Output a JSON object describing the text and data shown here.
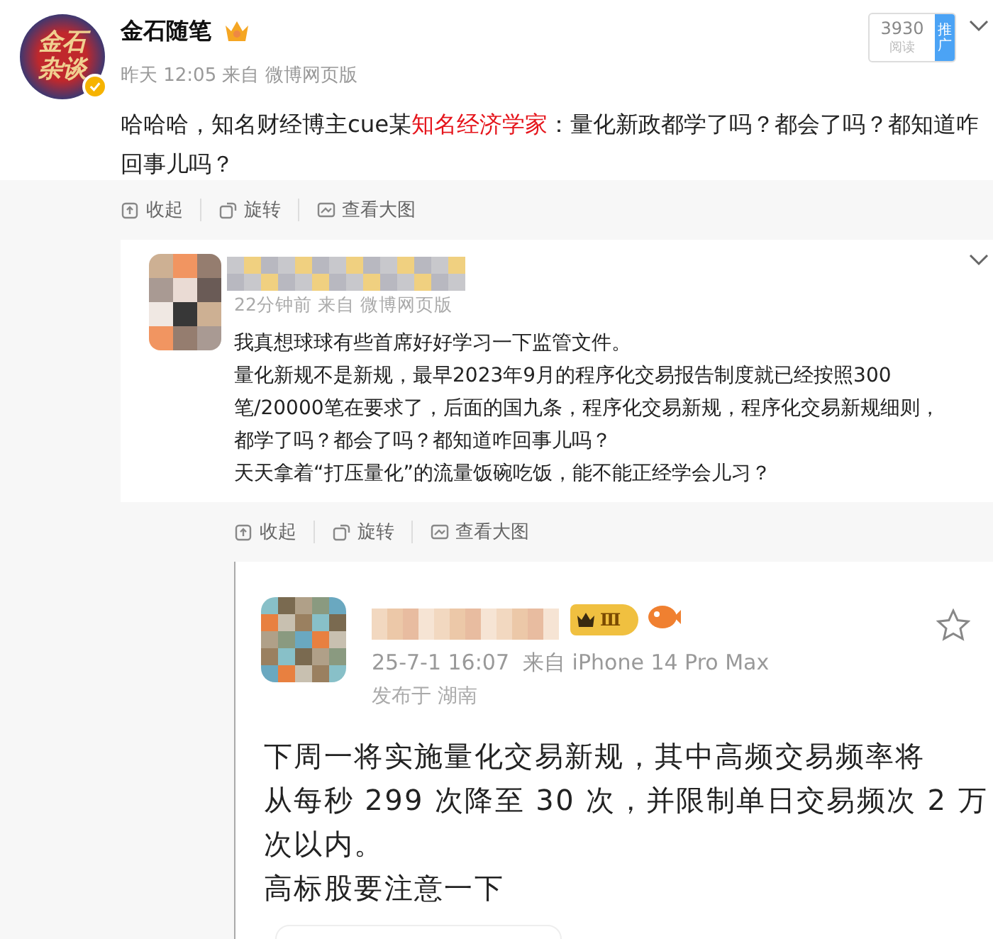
{
  "post": {
    "author": "金石随笔",
    "avatar_text": [
      "金石",
      "杂谈"
    ],
    "verified": true,
    "meta": "昨天 12:05 来自 微博网页版",
    "read_count": "3930",
    "read_label": "阅读",
    "promo": "推广",
    "text_parts": [
      {
        "text": "哈哈哈，知名财经博主cue某",
        "highlight": false
      },
      {
        "text": "知名经济学家",
        "highlight": true
      },
      {
        "text": "：量化新政都学了吗？都会了吗？都知道咋回事儿吗？",
        "highlight": false
      }
    ]
  },
  "toolbar_1": [
    {
      "kind": "collapse",
      "label": "收起"
    },
    {
      "kind": "rotate",
      "label": "旋转"
    },
    {
      "kind": "enlarge",
      "label": "查看大图"
    }
  ],
  "repost": {
    "meta": "22分钟前 来自 微博网页版",
    "lines": [
      "我真想球球有些首席好好学习一下监管文件。",
      "量化新规不是新规，最早2023年9月的程序化交易报告制度就已经按照300",
      "笔/20000笔在要求了，后面的国九条，程序化交易新规，程序化交易新规细则，",
      "都学了吗？都会了吗？都知道咋回事儿吗？",
      "天天拿着“打压量化”的流量饭碗吃饭，能不能正经学会儿习？"
    ]
  },
  "toolbar_2": [
    {
      "kind": "collapse",
      "label": "收起"
    },
    {
      "kind": "rotate",
      "label": "旋转"
    },
    {
      "kind": "enlarge",
      "label": "查看大图"
    }
  ],
  "screenshot": {
    "badge": "Ⅲ",
    "meta": "25-7-1 16:07  来自 iPhone 14 Pro Max",
    "location": "发布于 湖南",
    "lines": [
      "下周一将实施量化交易新规，其中高频交易频率将",
      "从每秒 299 次降至 30 次，并限制单日交易频次 2 万",
      "次以内。",
      "高标股要注意一下"
    ]
  }
}
